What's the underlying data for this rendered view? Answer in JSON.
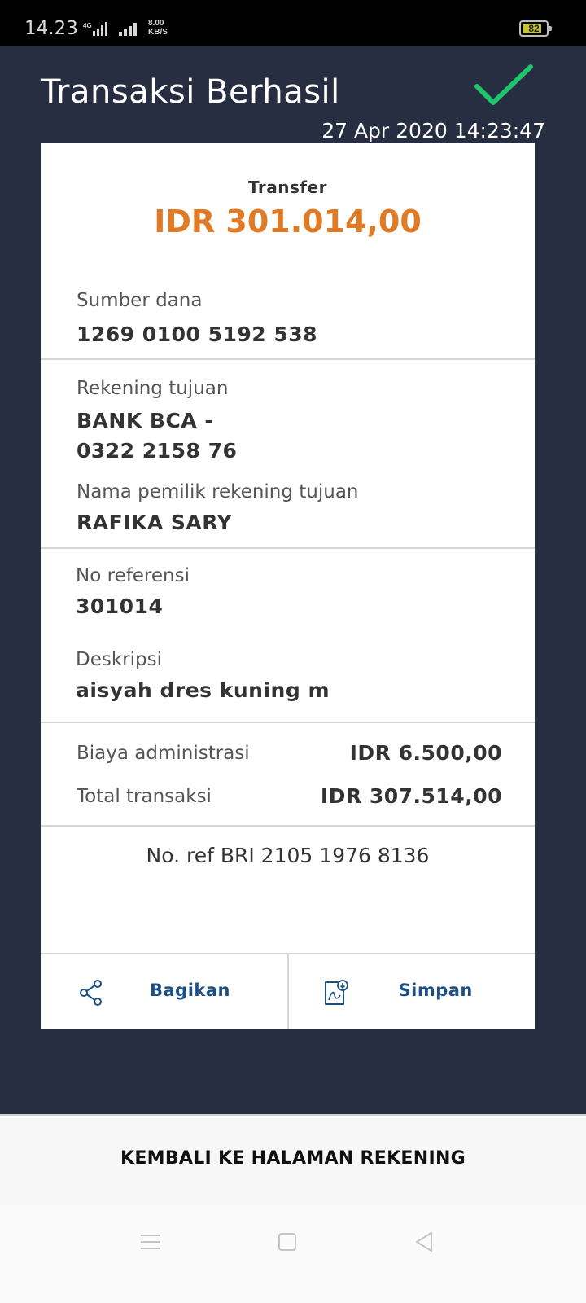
{
  "status_bar": {
    "time": "14.23",
    "network_type": "4G",
    "speed_value": "8.00",
    "speed_unit": "KB/S",
    "battery_level": "82",
    "battery_fraction": 0.82
  },
  "header": {
    "title": "Transaksi Berhasil",
    "datetime": "27 Apr 2020 14:23:47",
    "status_icon": "check-icon",
    "check_color": "#1fc56a"
  },
  "receipt": {
    "type": "Transfer",
    "amount": "IDR 301.014,00",
    "source": {
      "label": "Sumber dana",
      "value": "1269 0100 5192 538"
    },
    "destination": {
      "label": "Rekening tujuan",
      "bank": "BANK BCA -",
      "account": "0322 2158 76",
      "owner_label": "Nama pemilik rekening tujuan",
      "owner": "RAFIKA SARY"
    },
    "reference": {
      "label": "No referensi",
      "value": "301014"
    },
    "description": {
      "label": "Deskripsi",
      "value": "aisyah dres kuning m"
    },
    "admin_fee": {
      "label": "Biaya administrasi",
      "value": "IDR 6.500,00"
    },
    "total": {
      "label": "Total transaksi",
      "value": "IDR 307.514,00"
    },
    "bri_ref": "No. ref BRI 2105 1976 8136",
    "actions": {
      "share": {
        "label": "Bagikan",
        "icon": "share-icon"
      },
      "save": {
        "label": "Simpan",
        "icon": "save-pdf-icon"
      }
    }
  },
  "footer": {
    "back_label": "KEMBALI KE HALAMAN REKENING"
  },
  "nav": {
    "items": [
      "menu-icon",
      "home-icon",
      "back-icon"
    ]
  },
  "colors": {
    "background": "#272e41",
    "amount": "#e07a25",
    "action_text": "#1c4f83"
  }
}
